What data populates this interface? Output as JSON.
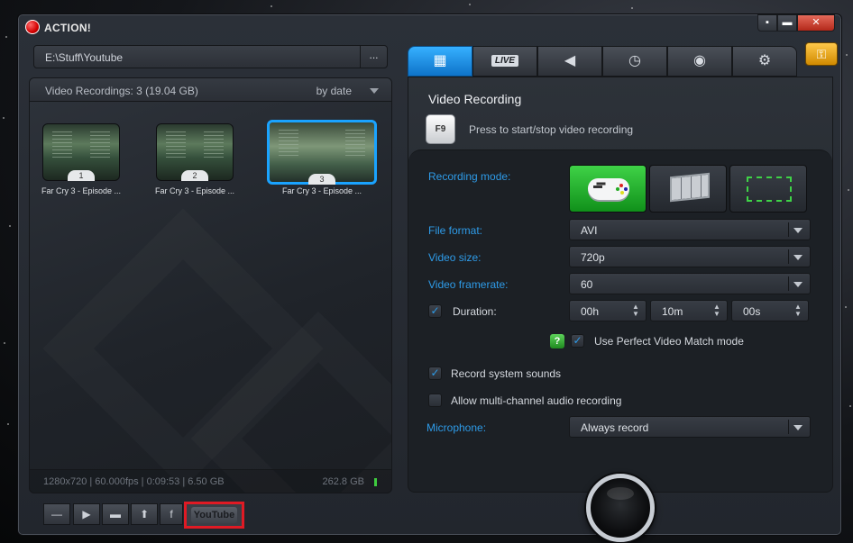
{
  "app": {
    "title": "ACTION!"
  },
  "window_controls": {
    "minimize": "▪",
    "maximize": "▬",
    "close": "✕"
  },
  "path_bar": {
    "path": "E:\\Stuff\\Youtube",
    "browse_label": "..."
  },
  "recordings": {
    "title": "Video Recordings: 3 (19.04 GB)",
    "sort_label": "by date",
    "items": [
      {
        "number": "1",
        "label": "Far Cry 3 - Episode ...",
        "selected": false
      },
      {
        "number": "2",
        "label": "Far Cry 3 - Episode ...",
        "selected": false
      },
      {
        "number": "3",
        "label": "Far Cry 3 - Episode ...",
        "selected": true
      }
    ],
    "footer_info": "1280x720 | 60.000fps | 0:09:53 | 6.50 GB",
    "footer_space": "262.8 GB"
  },
  "toolbar": {
    "buttons": [
      {
        "name": "remove-button",
        "icon": "minus-icon",
        "glyph": "—"
      },
      {
        "name": "play-button",
        "icon": "play-icon",
        "glyph": "▶"
      },
      {
        "name": "open-folder-button",
        "icon": "folder-icon",
        "glyph": "▬"
      },
      {
        "name": "upload-button",
        "icon": "upload-icon",
        "glyph": "⬆"
      },
      {
        "name": "facebook-button",
        "icon": "facebook-icon",
        "glyph": "f"
      }
    ],
    "youtube_label": "YouTube"
  },
  "tabs": [
    {
      "name": "tab-video",
      "icon": "film-icon",
      "glyph": "▦",
      "active": true
    },
    {
      "name": "tab-live",
      "icon": "live-icon",
      "label": "LIVE",
      "active": false
    },
    {
      "name": "tab-audio",
      "icon": "speaker-icon",
      "glyph": "◀",
      "active": false
    },
    {
      "name": "tab-benchmark",
      "icon": "stopwatch-icon",
      "glyph": "◷",
      "active": false
    },
    {
      "name": "tab-screenshot",
      "icon": "camera-icon",
      "glyph": "◉",
      "active": false
    },
    {
      "name": "tab-settings",
      "icon": "gear-icon",
      "glyph": "⚙",
      "active": false
    }
  ],
  "key_button_icon": "key-icon",
  "video_panel": {
    "title": "Video Recording",
    "hotkey": "F9",
    "hotkey_desc": "Press to start/stop video recording",
    "recording_mode_label": "Recording mode:",
    "recording_modes": [
      {
        "name": "game-mode",
        "icon": "gamepad-icon",
        "active": true
      },
      {
        "name": "desktop-mode",
        "icon": "desktop-icon",
        "active": false
      },
      {
        "name": "region-mode",
        "icon": "region-icon",
        "active": false
      }
    ],
    "file_format_label": "File format:",
    "file_format": "AVI",
    "video_size_label": "Video size:",
    "video_size": "720p",
    "video_framerate_label": "Video framerate:",
    "video_framerate": "60",
    "duration_label": "Duration:",
    "duration_checked": true,
    "duration_hours": "00h",
    "duration_minutes": "10m",
    "duration_seconds": "00s",
    "help_label": "?",
    "perfect_match_label": "Use Perfect Video Match mode",
    "perfect_match_checked": true,
    "record_sounds_label": "Record system sounds",
    "record_sounds_checked": true,
    "multichannel_label": "Allow multi-channel audio recording",
    "multichannel_checked": false,
    "microphone_label": "Microphone:",
    "microphone": "Always record"
  },
  "colors": {
    "accent": "#1aa3ff",
    "active_mode": "#2ebd35",
    "label_blue": "#2e9be8",
    "highlight_box": "#e01a24"
  }
}
